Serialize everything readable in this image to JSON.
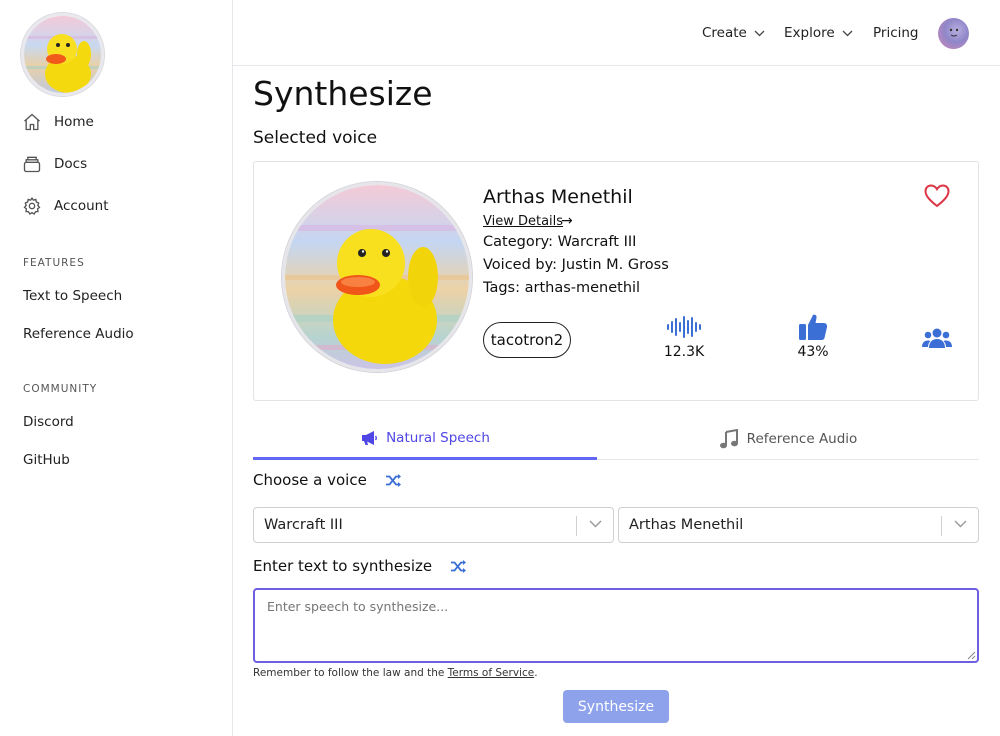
{
  "sidebar": {
    "logo_icon": "rubber-duck-logo",
    "nav": [
      {
        "label": "Home",
        "icon": "home-icon"
      },
      {
        "label": "Docs",
        "icon": "docs-icon"
      },
      {
        "label": "Account",
        "icon": "gear-icon"
      }
    ],
    "features_label": "FEATURES",
    "features": [
      "Text to Speech",
      "Reference Audio"
    ],
    "community_label": "COMMUNITY",
    "community": [
      "Discord",
      "GitHub"
    ]
  },
  "topbar": {
    "create": "Create",
    "explore": "Explore",
    "pricing": "Pricing"
  },
  "main": {
    "title": "Synthesize",
    "selected_voice_label": "Selected voice",
    "voice": {
      "name": "Arthas Menethil",
      "view_details": "View Details",
      "arrow": "→",
      "category": "Category: Warcraft III",
      "voiced_by": "Voiced by: Justin M. Gross",
      "tags": "Tags: arthas-menethil",
      "model": "tacotron2",
      "uses": "12.3K",
      "rating": "43%"
    },
    "tabs": {
      "natural": "Natural Speech",
      "reference": "Reference Audio"
    },
    "choose_voice_label": "Choose a voice",
    "category_select": "Warcraft III",
    "voice_select": "Arthas Menethil",
    "enter_text_label": "Enter text to synthesize",
    "textarea_placeholder": "Enter speech to synthesize...",
    "disclaimer_prefix": "Remember to follow the law and the ",
    "terms_link": "Terms of Service",
    "disclaimer_suffix": ".",
    "synthesize_button": "Synthesize"
  },
  "colors": {
    "accent": "#6366f1",
    "button": "#8ea2ec",
    "heart": "#dc3545",
    "icon_blue": "#3b6fd6"
  }
}
